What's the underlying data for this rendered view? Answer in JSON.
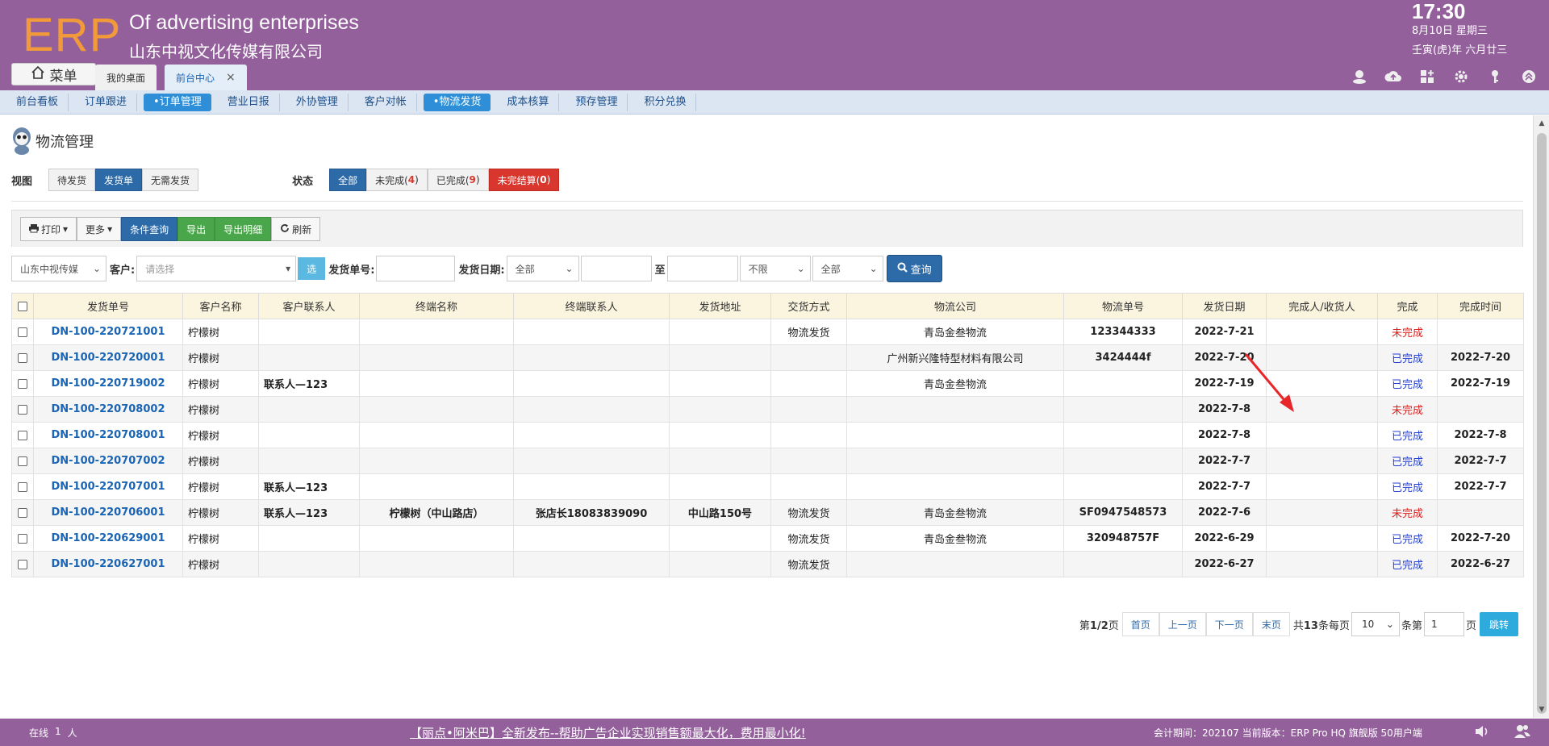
{
  "header": {
    "logo": "ERP",
    "company_en": "Of advertising enterprises",
    "company_cn": "山东中视文化传媒有限公司",
    "time": "17:30",
    "date": "8月10日 星期三",
    "lunar": "壬寅(虎)年 六月廿三",
    "menu_label": "菜单",
    "tabs": [
      {
        "label": "我的桌面"
      },
      {
        "label": "前台中心",
        "close": "×"
      }
    ]
  },
  "subnav": [
    {
      "label": "前台看板"
    },
    {
      "label": "订单跟进"
    },
    {
      "label": "•订单管理"
    },
    {
      "label": "营业日报"
    },
    {
      "label": "外协管理"
    },
    {
      "label": "客户对帐"
    },
    {
      "label": "•物流发货"
    },
    {
      "label": "成本核算"
    },
    {
      "label": "预存管理"
    },
    {
      "label": "积分兑换"
    }
  ],
  "page": {
    "title": "物流管理",
    "view_label": "视图",
    "views": [
      "待发货",
      "发货单",
      "无需发货"
    ],
    "status_label": "状态",
    "status": {
      "all": "全部",
      "incomplete": "未完成(",
      "incomplete_count": "4",
      "complete": "已完成(",
      "complete_count": "9",
      "unsettled": "未完结算(",
      "unsettled_count": "0",
      "close": ")"
    }
  },
  "toolbar": {
    "print": "打印",
    "more": "更多",
    "condition": "条件查询",
    "export": "导出",
    "export_detail": "导出明细",
    "refresh": "刷新"
  },
  "filter": {
    "company": "山东中视传媒",
    "customer_label": "客户:",
    "customer_placeholder": "请选择",
    "select_btn": "选",
    "ship_no_label": "发货单号:",
    "ship_date_label": "发货日期:",
    "date_range": "全部",
    "to_label": "至",
    "limit": "不限",
    "all": "全部",
    "query": "查询"
  },
  "table": {
    "columns": [
      "发货单号",
      "客户名称",
      "客户联系人",
      "终端名称",
      "终端联系人",
      "发货地址",
      "交货方式",
      "物流公司",
      "物流单号",
      "发货日期",
      "完成人/收货人",
      "完成",
      "完成时间"
    ],
    "rows": [
      {
        "no": "DN-100-220721001",
        "customer": "柠檬树",
        "contact": "",
        "terminal": "",
        "t_contact": "",
        "address": "",
        "method": "物流发货",
        "company": "青岛金叁物流",
        "track": "123344333",
        "date": "2022-7-21",
        "receiver": "",
        "status": "未完成",
        "done": false,
        "done_time": ""
      },
      {
        "no": "DN-100-220720001",
        "customer": "柠檬树",
        "contact": "",
        "terminal": "",
        "t_contact": "",
        "address": "",
        "method": "",
        "company": "广州新兴隆特型材料有限公司",
        "track": "3424444f",
        "date": "2022-7-20",
        "receiver": "",
        "status": "已完成",
        "done": true,
        "done_time": "2022-7-20"
      },
      {
        "no": "DN-100-220719002",
        "customer": "柠檬树",
        "contact": "联系人—123",
        "terminal": "",
        "t_contact": "",
        "address": "",
        "method": "",
        "company": "青岛金叁物流",
        "track": "",
        "date": "2022-7-19",
        "receiver": "",
        "status": "已完成",
        "done": true,
        "done_time": "2022-7-19"
      },
      {
        "no": "DN-100-220708002",
        "customer": "柠檬树",
        "contact": "",
        "terminal": "",
        "t_contact": "",
        "address": "",
        "method": "",
        "company": "",
        "track": "",
        "date": "2022-7-8",
        "receiver": "",
        "status": "未完成",
        "done": false,
        "done_time": ""
      },
      {
        "no": "DN-100-220708001",
        "customer": "柠檬树",
        "contact": "",
        "terminal": "",
        "t_contact": "",
        "address": "",
        "method": "",
        "company": "",
        "track": "",
        "date": "2022-7-8",
        "receiver": "",
        "status": "已完成",
        "done": true,
        "done_time": "2022-7-8"
      },
      {
        "no": "DN-100-220707002",
        "customer": "柠檬树",
        "contact": "",
        "terminal": "",
        "t_contact": "",
        "address": "",
        "method": "",
        "company": "",
        "track": "",
        "date": "2022-7-7",
        "receiver": "",
        "status": "已完成",
        "done": true,
        "done_time": "2022-7-7"
      },
      {
        "no": "DN-100-220707001",
        "customer": "柠檬树",
        "contact": "联系人—123",
        "terminal": "",
        "t_contact": "",
        "address": "",
        "method": "",
        "company": "",
        "track": "",
        "date": "2022-7-7",
        "receiver": "",
        "status": "已完成",
        "done": true,
        "done_time": "2022-7-7"
      },
      {
        "no": "DN-100-220706001",
        "customer": "柠檬树",
        "contact": "联系人—123",
        "terminal": "柠檬树（中山路店）",
        "t_contact": "张店长18083839090",
        "address": "中山路150号",
        "method": "物流发货",
        "company": "青岛金叁物流",
        "track": "SF0947548573",
        "date": "2022-7-6",
        "receiver": "",
        "status": "未完成",
        "done": false,
        "done_time": ""
      },
      {
        "no": "DN-100-220629001",
        "customer": "柠檬树",
        "contact": "",
        "terminal": "",
        "t_contact": "",
        "address": "",
        "method": "物流发货",
        "company": "青岛金叁物流",
        "track": "320948757F",
        "date": "2022-6-29",
        "receiver": "",
        "status": "已完成",
        "done": true,
        "done_time": "2022-7-20"
      },
      {
        "no": "DN-100-220627001",
        "customer": "柠檬树",
        "contact": "",
        "terminal": "",
        "t_contact": "",
        "address": "",
        "method": "物流发货",
        "company": "",
        "track": "",
        "date": "2022-6-27",
        "receiver": "",
        "status": "已完成",
        "done": true,
        "done_time": "2022-6-27"
      }
    ]
  },
  "pager": {
    "prefix": "第",
    "current": "1",
    "sep": "/",
    "total_pages": "2",
    "page_suffix": "页",
    "first": "首页",
    "prev": "上一页",
    "next": "下一页",
    "last": "末页",
    "total_prefix": "共",
    "total": "13",
    "total_suffix": "条每页",
    "per_page": "10",
    "goto_prefix": "条第",
    "goto_value": "1",
    "goto_suffix": "页",
    "go": "跳转"
  },
  "footer": {
    "online_label": "在线",
    "online_count": "1",
    "online_unit": "人",
    "marquee": "【丽点•阿米巴】全新发布--帮助广告企业实现销售额最大化，费用最小化!",
    "period": "会计期间：202107 当前版本：ERP Pro HQ 旗舰版 50用户端"
  },
  "colors": {
    "brand": "#93609c",
    "logo": "#f29a3a",
    "primary": "#2c6aa8",
    "success": "#4aa64a",
    "danger": "#d9372e",
    "header_row": "#fbf5df"
  },
  "icons": [
    "home-icon",
    "user-icon",
    "cloud-icon",
    "grid-icon",
    "gear-icon",
    "key-icon",
    "collapse-icon",
    "print-icon",
    "refresh-icon",
    "search-icon",
    "volume-icon",
    "users-icon"
  ]
}
